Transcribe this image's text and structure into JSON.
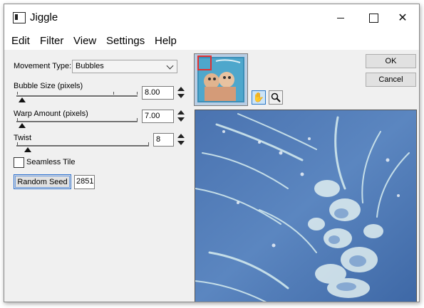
{
  "window": {
    "title": "Jiggle"
  },
  "menu": [
    "Edit",
    "Filter",
    "View",
    "Settings",
    "Help"
  ],
  "movement": {
    "label": "Movement Type:",
    "value": "Bubbles"
  },
  "bubble_size": {
    "label": "Bubble Size (pixels)",
    "value": "8.00"
  },
  "warp_amount": {
    "label": "Warp Amount (pixels)",
    "value": "7.00"
  },
  "twist": {
    "label": "Twist",
    "value": "8"
  },
  "seamless": {
    "label": "Seamless Tile",
    "checked": false
  },
  "random_seed": {
    "label": "Random Seed",
    "value": "2851"
  },
  "buttons": {
    "ok": "OK",
    "cancel": "Cancel"
  },
  "tools": {
    "pan": "pan-hand-icon",
    "zoom": "zoom-magnifier-icon"
  },
  "colors": {
    "preview_bg": "#5a7fb8",
    "selection_box": "#e23030"
  }
}
